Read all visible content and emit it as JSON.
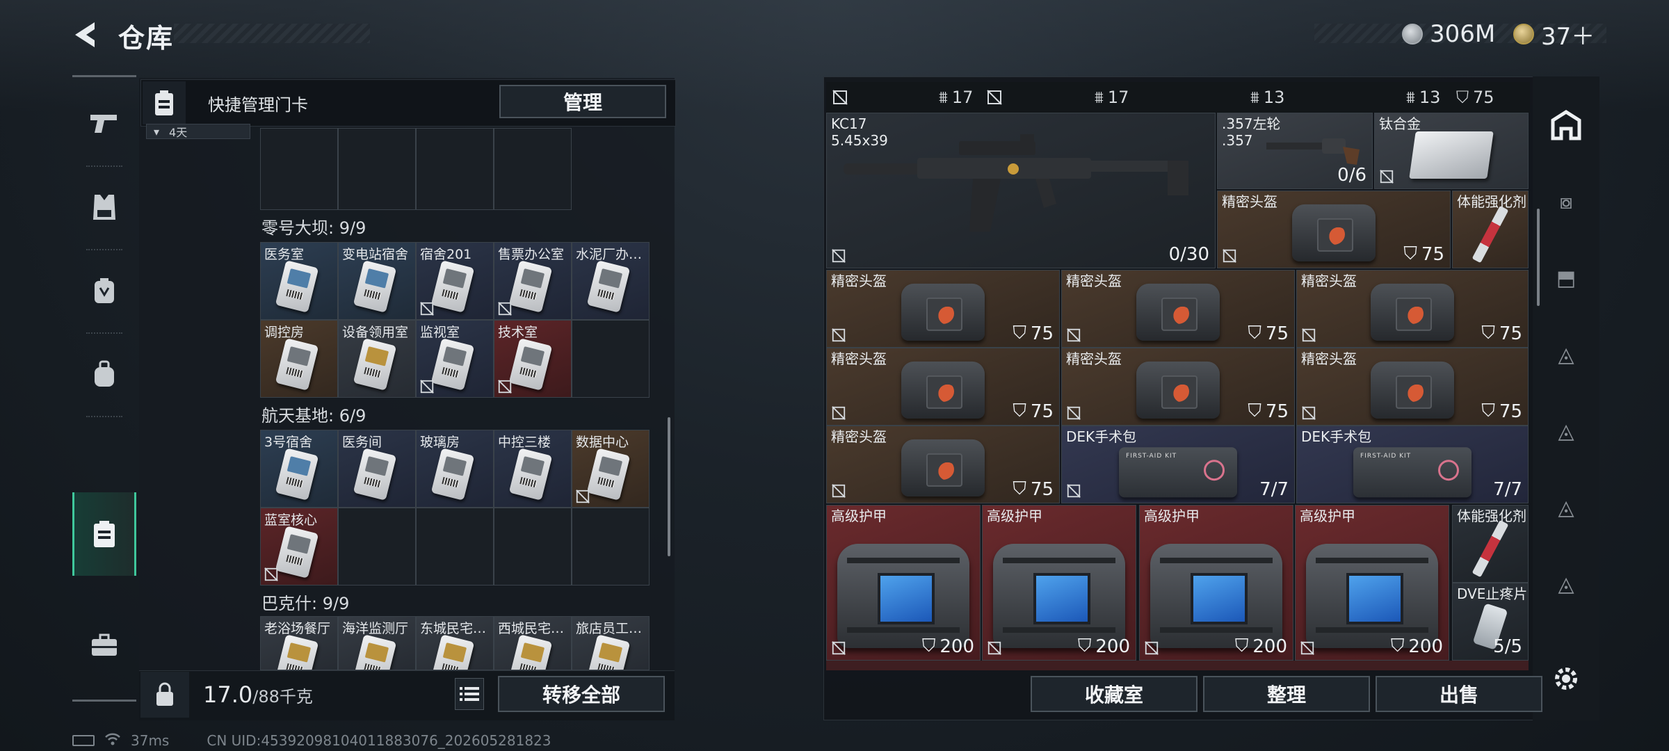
{
  "header": {
    "title": "仓库",
    "currency_silver": "306M",
    "currency_gold": "37＋"
  },
  "quick": {
    "label": "快捷管理门卡",
    "manage_label": "管理",
    "mini_count": "4天"
  },
  "sections": [
    {
      "title": "零号大坝: 9/9",
      "cards": [
        {
          "name": "医务室",
          "color": "blue",
          "locked": false
        },
        {
          "name": "变电站宿舍",
          "color": "blue",
          "locked": false
        },
        {
          "name": "宿舍201",
          "color": "navy",
          "locked": true
        },
        {
          "name": "售票办公室",
          "color": "navy",
          "locked": true
        },
        {
          "name": "水泥厂办…",
          "color": "navy",
          "locked": false
        },
        {
          "name": "调控房",
          "color": "brown",
          "locked": false
        },
        {
          "name": "设备领用室",
          "color": "gray",
          "locked": false
        },
        {
          "name": "监视室",
          "color": "navy",
          "locked": true
        },
        {
          "name": "技术室",
          "color": "red",
          "locked": true
        }
      ]
    },
    {
      "title": "航天基地: 6/9",
      "cards": [
        {
          "name": "3号宿舍",
          "color": "blue",
          "locked": false
        },
        {
          "name": "医务间",
          "color": "navy",
          "locked": false
        },
        {
          "name": "玻璃房",
          "color": "navy",
          "locked": false
        },
        {
          "name": "中控三楼",
          "color": "navy",
          "locked": false
        },
        {
          "name": "数据中心",
          "color": "brown",
          "locked": true
        },
        {
          "name": "蓝室核心",
          "color": "red",
          "locked": true
        }
      ]
    },
    {
      "title": "巴克什: 9/9",
      "cards": [
        {
          "name": "老浴场餐厅",
          "color": "gray",
          "locked": false
        },
        {
          "name": "海洋监测厅",
          "color": "gray",
          "locked": false
        },
        {
          "name": "东城民宅…",
          "color": "gray",
          "locked": false
        },
        {
          "name": "西城民宅…",
          "color": "gray",
          "locked": false
        },
        {
          "name": "旅店员工…",
          "color": "gray",
          "locked": false
        }
      ]
    }
  ],
  "footer": {
    "weight": "17.0",
    "weight_max": "/88千克",
    "move_all": "转移全部"
  },
  "status": {
    "ping": "37ms",
    "uid": "CN UID:4539209810401188307​6_202605281823"
  },
  "stash_top": [
    {
      "label": "17"
    },
    {
      "label": "17"
    },
    {
      "label": "13"
    },
    {
      "label": "13"
    },
    {
      "label": "75"
    }
  ],
  "stash": {
    "kc17": {
      "name": "KC17",
      "sub": "5.45x39",
      "ammo": "0/30"
    },
    "revolver": {
      "name": ".357左轮",
      "sub": ".357",
      "ammo": "0/6"
    },
    "titanium": {
      "name": "钛合金"
    },
    "helmet_name": "精密头盔",
    "helmet_val": "75",
    "stim_name": "体能强化剂",
    "medkit_name": "DEK手术包",
    "medkit_val": "7/7",
    "armor_name": "高级护甲",
    "armor_val": "200",
    "painkiller": {
      "name": "DVE止疼片",
      "val": "5/5"
    }
  },
  "actions": {
    "collection": "收藏室",
    "sort": "整理",
    "sell": "出售"
  }
}
